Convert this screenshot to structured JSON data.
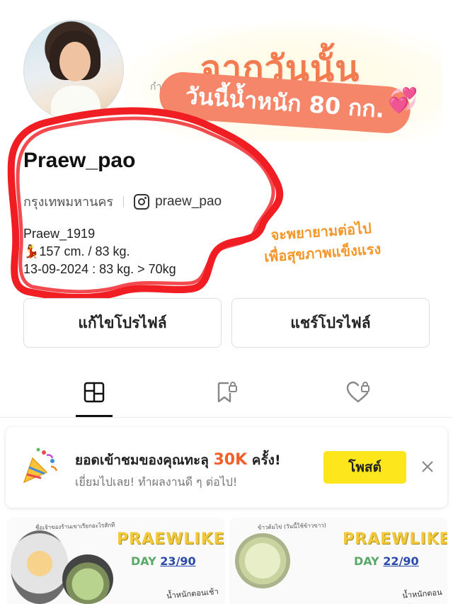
{
  "profile": {
    "username": "Praew_pao",
    "location": "กรุงเทพมหานคร",
    "instagram": "praew_pao",
    "bio": [
      "Praew_1919",
      "💃157 cm. / 83 kg.",
      "13-09-2024 : 83 kg. > 70kg"
    ],
    "ghost_text": "กำ"
  },
  "sticker": {
    "title": "จากวันนั้น",
    "pill": "วันนี้น้ำหนัก 80 กก.",
    "hearts": "💞",
    "colors": {
      "title": "#f27b4f",
      "pill": "#f5866a"
    }
  },
  "annotation": [
    "จะพยายามต่อไป",
    "เพื่อสุขภาพแข็งแรง"
  ],
  "buttons": {
    "edit": "แก้ไขโปรไฟล์",
    "share": "แชร์โปรไฟล์"
  },
  "tabs": [
    {
      "name": "posts",
      "icon": "grid-icon",
      "active": true
    },
    {
      "name": "saved",
      "icon": "bookmark-lock-icon",
      "active": false
    },
    {
      "name": "liked",
      "icon": "heart-lock-icon",
      "active": false
    }
  ],
  "promo": {
    "icon": "party-popper-icon",
    "title_prefix": "ยอดเข้าชมของคุณทะลุ ",
    "title_highlight": "30K",
    "title_suffix": " ครั้ง!",
    "subtitle": "เยี่ยมไปเลย! ทำผลงานดี ๆ ต่อไป!",
    "button": "โพสต์",
    "colors": {
      "highlight": "#f2602a",
      "button": "#fde61b"
    }
  },
  "grid": [
    {
      "brand": "PRAEWLIKE",
      "day_label": "DAY",
      "day_num": "23/90",
      "note": "น้ำหนักตอนเช้า",
      "caption_top": "ชื่อเจ้าของร้านเขาเรียกอะไรสักที"
    },
    {
      "brand": "PRAEWLIKE",
      "day_label": "DAY",
      "day_num": "22/90",
      "note": "น้ำหนักตอนเช้า",
      "caption_top": "ข้าวต้มไข่ (วันนี้ใช้ข้าวขาว)"
    }
  ]
}
